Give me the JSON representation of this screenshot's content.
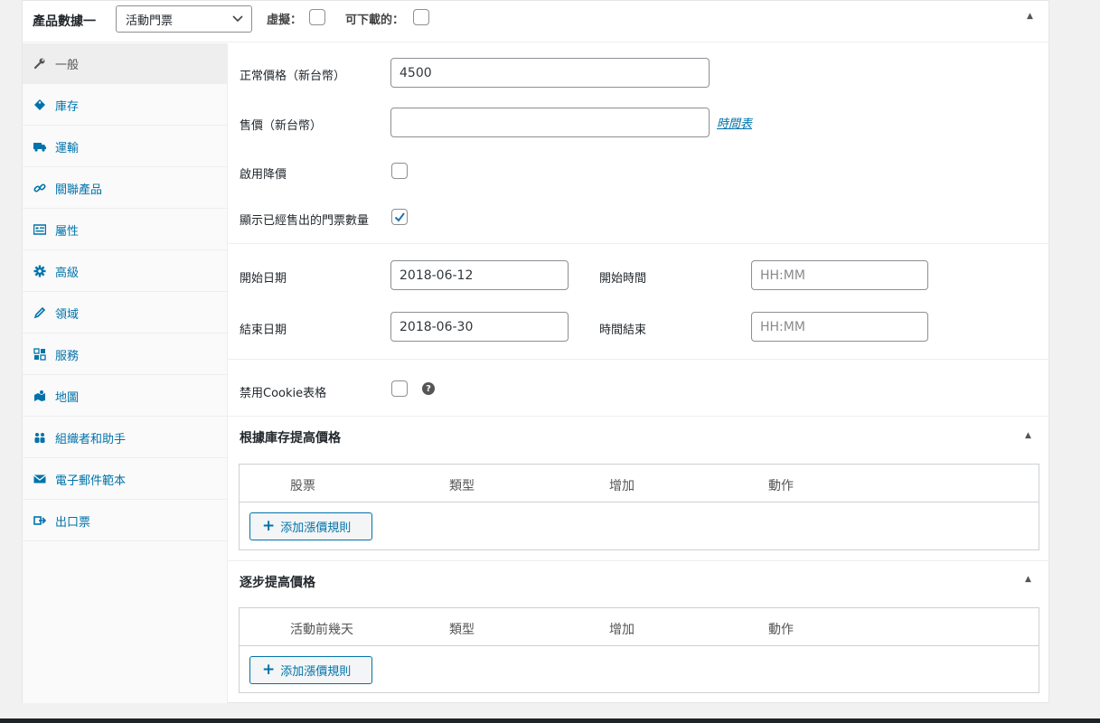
{
  "header": {
    "label": "產品數據一",
    "type_select": "活動門票",
    "virtual_label": "虛擬：",
    "virtual_checked": false,
    "downloadable_label": "可下載的：",
    "downloadable_checked": false
  },
  "tabs": [
    {
      "label": "一般",
      "icon": "wrench-icon",
      "active": true
    },
    {
      "label": "庫存",
      "icon": "tag-icon",
      "active": false
    },
    {
      "label": "運輸",
      "icon": "truck-icon",
      "active": false
    },
    {
      "label": "關聯產品",
      "icon": "link-icon",
      "active": false
    },
    {
      "label": "屬性",
      "icon": "list-card-icon",
      "active": false
    },
    {
      "label": "高級",
      "icon": "gear-icon",
      "active": false
    },
    {
      "label": "領域",
      "icon": "pencil-icon",
      "active": false
    },
    {
      "label": "服務",
      "icon": "grid-icon",
      "active": false
    },
    {
      "label": "地圖",
      "icon": "map-icon",
      "active": false
    },
    {
      "label": "組織者和助手",
      "icon": "users-icon",
      "active": false
    },
    {
      "label": "電子郵件範本",
      "icon": "envelope-icon",
      "active": false
    },
    {
      "label": "出口票",
      "icon": "export-icon",
      "active": false
    }
  ],
  "general": {
    "regular_price_label": "正常價格（新台幣）",
    "regular_price_value": "4500",
    "sale_price_label": "售價（新台幣）",
    "sale_price_value": "",
    "schedule_link": "時間表",
    "enable_discount_label": "啟用降價",
    "enable_discount_checked": false,
    "show_sold_label": "顯示已經售出的門票數量",
    "show_sold_checked": true,
    "start_date_label": "開始日期",
    "start_date_value": "2018-06-12",
    "start_time_label": "開始時間",
    "start_time_placeholder": "HH:MM",
    "end_date_label": "結束日期",
    "end_date_value": "2018-06-30",
    "end_time_label": "時間結束",
    "end_time_placeholder": "HH:MM",
    "disable_cookie_label": "禁用Cookie表格",
    "disable_cookie_checked": false
  },
  "stock_pricing": {
    "title": "根據庫存提高價格",
    "columns": [
      "股票",
      "類型",
      "增加",
      "動作"
    ],
    "add_button": "添加漲價規則"
  },
  "step_pricing": {
    "title": "逐步提高價格",
    "columns": [
      "活動前幾天",
      "類型",
      "增加",
      "動作"
    ],
    "add_button": "添加漲價規則"
  },
  "colors": {
    "accent": "#0073aa",
    "border": "#8c8f94"
  }
}
